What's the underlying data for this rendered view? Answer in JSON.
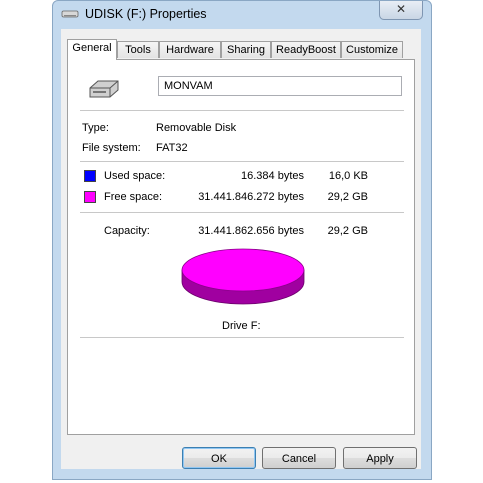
{
  "window": {
    "title": "UDISK (F:) Properties",
    "close_glyph": "✕"
  },
  "tabs": [
    {
      "label": "General",
      "active": true
    },
    {
      "label": "Tools"
    },
    {
      "label": "Hardware"
    },
    {
      "label": "Sharing"
    },
    {
      "label": "ReadyBoost"
    },
    {
      "label": "Customize"
    }
  ],
  "general": {
    "volume_label": "MONVAM",
    "type_label": "Type:",
    "type_value": "Removable Disk",
    "fs_label": "File system:",
    "fs_value": "FAT32",
    "used": {
      "label": "Used space:",
      "bytes": "16.384 bytes",
      "size": "16,0 KB",
      "color": "#0000ff"
    },
    "free": {
      "label": "Free space:",
      "bytes": "31.441.846.272 bytes",
      "size": "29,2 GB",
      "color": "#ff00ff"
    },
    "capacity": {
      "label": "Capacity:",
      "bytes": "31.441.862.656 bytes",
      "size": "29,2 GB"
    },
    "drive_caption": "Drive F:",
    "pie": {
      "used_fraction": 5e-07,
      "top_color": "#ff00ff",
      "side_color": "#a000a0"
    }
  },
  "buttons": {
    "ok": "OK",
    "cancel": "Cancel",
    "apply": "Apply"
  }
}
